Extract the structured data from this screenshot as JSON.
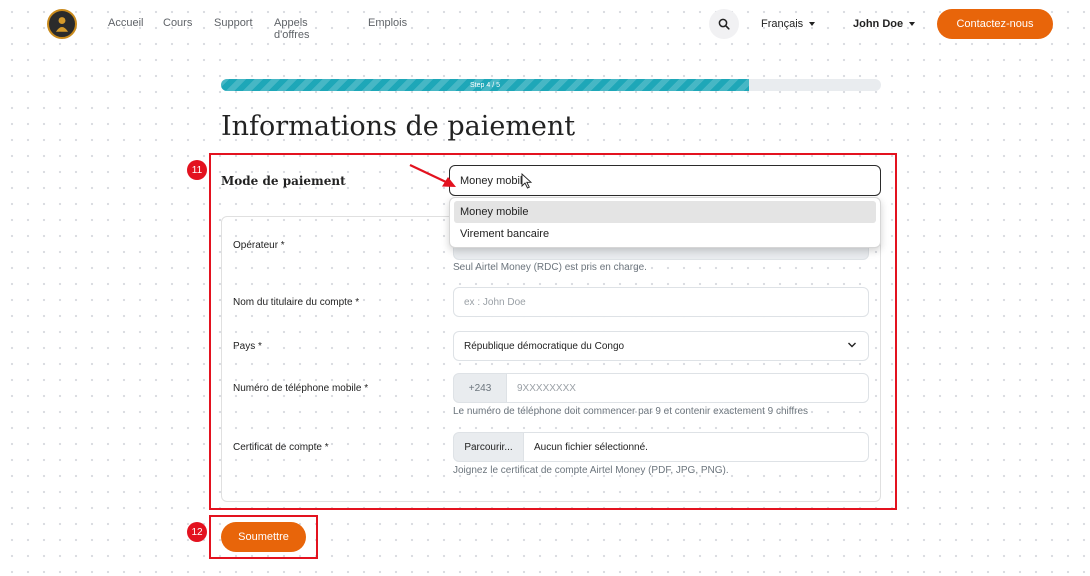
{
  "nav": {
    "links": [
      "Accueil",
      "Cours",
      "Support",
      "Appels d'offres",
      "Emplois"
    ],
    "language": "Français",
    "user": "John Doe",
    "contact_label": "Contactez-nous"
  },
  "progress": {
    "label": "Step 4 / 5",
    "fraction": 0.8,
    "color": "#1ea7b8"
  },
  "page": {
    "title": "Informations de paiement"
  },
  "annotations": {
    "badge_11": "11",
    "badge_12": "12",
    "color": "#e3121f"
  },
  "form": {
    "mode_label": "Mode de paiement",
    "mode_value": "Money mobile",
    "mode_options": [
      "Money mobile",
      "Virement bancaire"
    ],
    "operator_label": "Opérateur *",
    "operator_help": "Seul Airtel Money (RDC) est pris en charge.",
    "holder_label": "Nom du titulaire du compte *",
    "holder_placeholder": "ex : John Doe",
    "country_label": "Pays *",
    "country_value": "République démocratique du Congo",
    "phone_label": "Numéro de téléphone mobile *",
    "phone_prefix": "+243",
    "phone_placeholder": "9XXXXXXXX",
    "phone_help": "Le numéro de téléphone doit commencer par 9 et contenir exactement 9 chiffres",
    "certificate_label": "Certificat de compte *",
    "browse_label": "Parcourir...",
    "no_file_label": "Aucun fichier sélectionné.",
    "certificate_help": "Joignez le certificat de compte Airtel Money (PDF, JPG, PNG).",
    "submit_label": "Soumettre"
  },
  "colors": {
    "accent": "#e8650a"
  },
  "icons": {
    "logo": "organization-logo-icon",
    "search": "search-icon",
    "select_chevron": "chevron-down-icon",
    "pointer": "mouse-cursor-icon",
    "annotation_arrow": "arrow-icon"
  }
}
